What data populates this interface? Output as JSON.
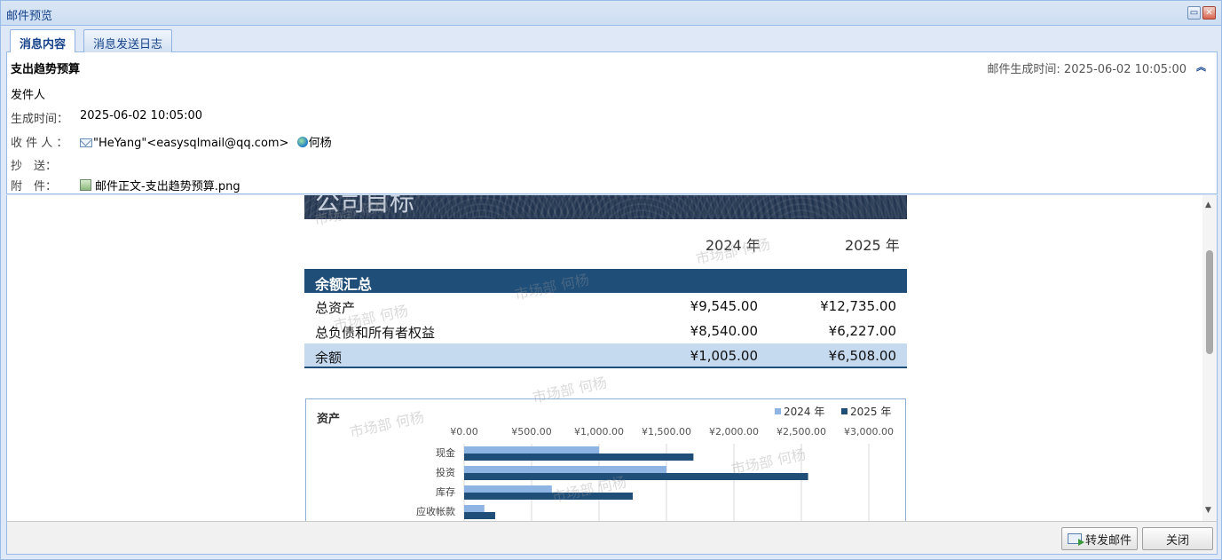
{
  "window": {
    "title": "邮件预览"
  },
  "tabs": [
    {
      "label": "消息内容",
      "active": true
    },
    {
      "label": "消息发送日志",
      "active": false
    }
  ],
  "header": {
    "subject": "支出趋势预算",
    "gen_time_right": "邮件生成时间: 2025-06-02 10:05:00",
    "sender_label": "发件人",
    "gen_time_label": "生成时间：",
    "gen_time_value": "2025-06-02 10:05:00",
    "to_label": "收 件 人 ：",
    "to_address": "\"HeYang\"<easysqlmail@qq.com>",
    "to_name": "何杨",
    "cc_label": "抄　送：",
    "attach_label": "附　件：",
    "attachment": "邮件正文-支出趋势预算.png"
  },
  "document": {
    "banner_title": "公司目标",
    "year_headers": [
      "2024 年",
      "2025 年"
    ],
    "summary_title": "余额汇总",
    "rows": [
      {
        "name": "总资产",
        "y2024": "¥9,545.00",
        "y2025": "¥12,735.00"
      },
      {
        "name": "总负债和所有者权益",
        "y2024": "¥8,540.00",
        "y2025": "¥6,227.00"
      },
      {
        "name": "余额",
        "y2024": "¥1,005.00",
        "y2025": "¥6,508.00"
      }
    ],
    "watermark": "市场部 何杨"
  },
  "chart_data": {
    "type": "bar",
    "orientation": "horizontal",
    "title": "资产",
    "categories": [
      "现金",
      "投资",
      "库存",
      "应收帐款"
    ],
    "series": [
      {
        "name": "2024 年",
        "values": [
          1000,
          1500,
          650,
          150
        ]
      },
      {
        "name": "2025 年",
        "values": [
          1700,
          2550,
          1250,
          230
        ]
      }
    ],
    "xlim": [
      0,
      3000
    ],
    "x_ticks": [
      "¥0.00",
      "¥500.00",
      "¥1,000.00",
      "¥1,500.00",
      "¥2,000.00",
      "¥2,500.00",
      "¥3,000.00"
    ],
    "grid": true,
    "legend_position": "top-right",
    "colors": {
      "2024": "#8eb4e3",
      "2025": "#1f4e79"
    }
  },
  "footer": {
    "forward_label": "转发邮件",
    "close_label": "关闭"
  }
}
